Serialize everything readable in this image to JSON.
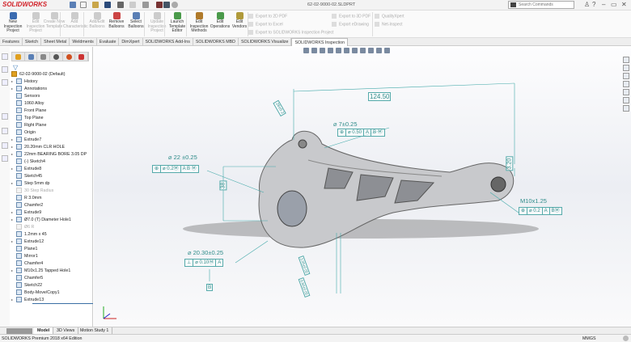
{
  "app": {
    "logo": "SOLIDWORKS",
    "document_title": "62-02-9000-02.SLDPRT",
    "search_placeholder": "Search Commands",
    "window_controls": [
      "?",
      "–",
      "▭",
      "✕"
    ]
  },
  "ribbon": {
    "buttons": [
      {
        "label": "New Inspection Project",
        "enabled": true,
        "color": "#3b6bb0"
      },
      {
        "label": "Edit Inspection Project",
        "enabled": false,
        "color": "#ccc"
      },
      {
        "label": "Create New Template",
        "enabled": false,
        "color": "#ccc"
      },
      {
        "label": "Add Characteristic",
        "enabled": false,
        "color": "#ccc"
      },
      {
        "label": "Add/Edit Balloons",
        "enabled": false,
        "color": "#ccc"
      },
      {
        "label": "Remove Balloons",
        "enabled": true,
        "color": "#c44"
      },
      {
        "label": "Select Balloons",
        "enabled": true,
        "color": "#5a7fb5"
      },
      {
        "label": "Update Inspection Project",
        "enabled": false,
        "color": "#ccc"
      },
      {
        "label": "Launch Template Editor",
        "enabled": true,
        "color": "#4a9a4a"
      },
      {
        "label": "Edit Inspection Methods",
        "enabled": true,
        "color": "#b07a2a"
      },
      {
        "label": "Edit Operations",
        "enabled": true,
        "color": "#4a9a4a"
      },
      {
        "label": "Edit Vendors",
        "enabled": true,
        "color": "#b09a3a"
      }
    ],
    "small_buttons": [
      "Export to 2D PDF",
      "Export to Excel",
      "Export to SOLIDWORKS Inspection Project",
      "Export to 3D PDF",
      "Export eDrawing",
      "QualityXpert",
      "Net-Inspect"
    ]
  },
  "tabs": [
    "Features",
    "Sketch",
    "Sheet Metal",
    "Weldments",
    "Evaluate",
    "DimXpert",
    "SOLIDWORKS Add-Ins",
    "SOLIDWORKS MBD",
    "SOLIDWORKS Visualize",
    "SOLIDWORKS Inspection"
  ],
  "active_tab": "SOLIDWORKS Inspection",
  "tree": {
    "root": "62-02-9000-02  (Default)",
    "items": [
      {
        "label": "History",
        "expand": true
      },
      {
        "label": "Annotations",
        "expand": true
      },
      {
        "label": "Sensors"
      },
      {
        "label": "1060 Alloy"
      },
      {
        "label": "Front Plane"
      },
      {
        "label": "Top Plane"
      },
      {
        "label": "Right Plane"
      },
      {
        "label": "Origin"
      },
      {
        "label": "Extrude7",
        "expand": true
      },
      {
        "label": "20.20mm CLR HOLE",
        "expand": true
      },
      {
        "label": "22mm BEARING BORE 3.05 DP",
        "expand": true
      },
      {
        "label": "(-) Sketch4"
      },
      {
        "label": "Extrude8",
        "expand": true
      },
      {
        "label": "Sketch45"
      },
      {
        "label": "Step 5mm dp",
        "expand": true
      },
      {
        "label": "30 Step Radius",
        "dim": true
      },
      {
        "label": "R 3.0mm"
      },
      {
        "label": "Chamfer2"
      },
      {
        "label": "Extrude9",
        "expand": true
      },
      {
        "label": "Ø7.0 (T) Diameter Hole1",
        "expand": true
      },
      {
        "label": "Ø6 R",
        "dim": true
      },
      {
        "label": "1.2mm x 45"
      },
      {
        "label": "Extrude12",
        "expand": true
      },
      {
        "label": "Plane1"
      },
      {
        "label": "Mirror1"
      },
      {
        "label": "Chamfer4"
      },
      {
        "label": "M10x1.25 Tapped Hole1",
        "expand": true
      },
      {
        "label": "Chamfer5"
      },
      {
        "label": "Sketch22"
      },
      {
        "label": "Body-Move/Copy1"
      },
      {
        "label": "Extrude13",
        "expand": true
      }
    ]
  },
  "annotations": {
    "dim_124": "124.50",
    "dim_28": "28±0.2",
    "hole7": "⌀ 7±0.25",
    "fcf7": [
      "⊕",
      "⌀ 0.50",
      "A",
      "B Ⓜ"
    ],
    "bore22": "⌀ 22 ±0.25",
    "fcf22": [
      "⊕",
      "⌀ 0.2Ⓜ",
      "A B Ⓜ"
    ],
    "dim_38": "38",
    "dim_320": "3.20",
    "thread": "M10x1.25",
    "fcf_thread": [
      "⊕",
      "⌀ 0.2",
      "A",
      "BⓂ"
    ],
    "bore20": "⌀ 20.30±0.25",
    "fcf20": [
      "⊥",
      "⌀ 0.10Ⓜ",
      "A"
    ],
    "datum_b": "B",
    "dim_305": "3.05±0.05",
    "dim_960": "9.60±0.05"
  },
  "bottom_tabs": [
    "Model",
    "3D Views",
    "Motion Study 1"
  ],
  "status": {
    "edition": "SOLIDWORKS Premium 2018 x64 Edition",
    "units": "MMGS"
  }
}
